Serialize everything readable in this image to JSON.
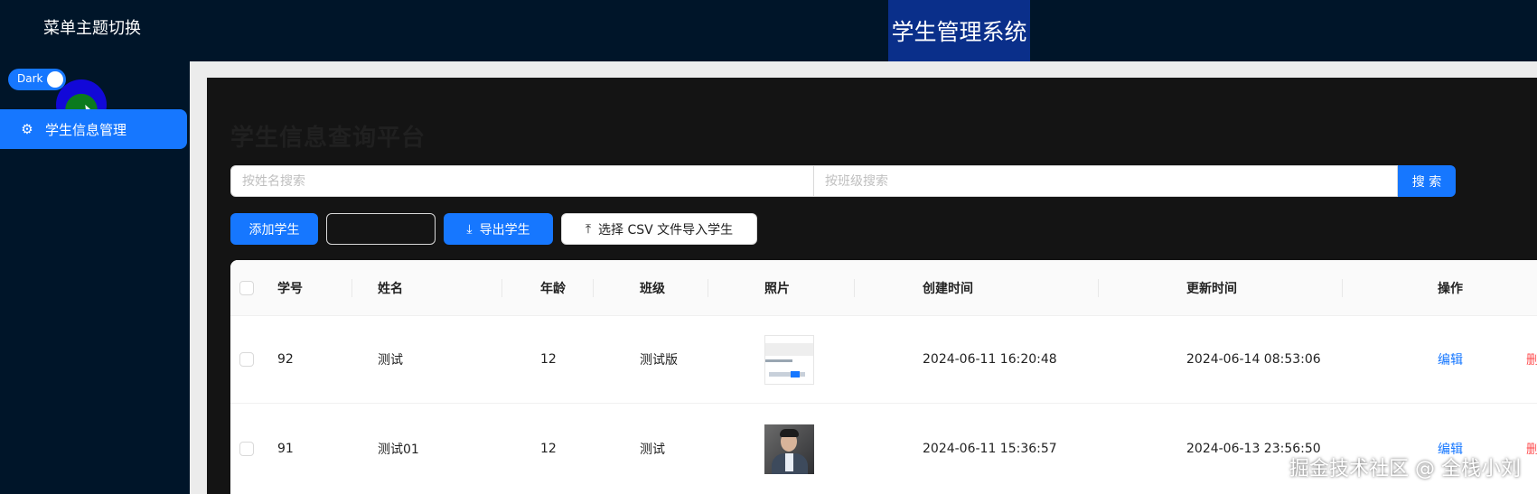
{
  "header": {
    "menu_theme_title": "菜单主题切换",
    "app_title": "学生管理系统"
  },
  "sidebar": {
    "theme_switch_label": "Dark",
    "theme_switch_on": true,
    "items": [
      {
        "label": "学生信息管理",
        "icon": "gear-icon",
        "selected": true
      }
    ]
  },
  "main": {
    "title": "学生信息查询平台",
    "search": {
      "name_placeholder": "按姓名搜索",
      "class_placeholder": "按班级搜索",
      "button_label": "搜 索"
    },
    "toolbar": {
      "add_label": "添加学生",
      "export_label": "导出学生",
      "export_icon": "download-icon",
      "import_label": "选择 CSV 文件导入学生",
      "import_icon": "upload-icon"
    },
    "table": {
      "columns": [
        "学号",
        "姓名",
        "年龄",
        "班级",
        "照片",
        "创建时间",
        "更新时间",
        "操作"
      ],
      "rows": [
        {
          "id": "92",
          "name": "测试",
          "age": "12",
          "class": "测试版",
          "photo": "screenshot-thumbnail",
          "created": "2024-06-11 16:20:48",
          "updated": "2024-06-14 08:53:06",
          "edit": "编辑",
          "delete": "删"
        },
        {
          "id": "91",
          "name": "测试01",
          "age": "12",
          "class": "测试",
          "photo": "portrait-thumbnail",
          "created": "2024-06-11 15:36:57",
          "updated": "2024-06-13 23:56:50",
          "edit": "编辑",
          "delete": "删"
        }
      ]
    }
  },
  "watermark": "掘金技术社区 @ 全栈小刘",
  "colors": {
    "sidebar_bg": "#001529",
    "accent": "#1677ff",
    "content_bg": "#141414",
    "danger": "#ff4d4f"
  }
}
